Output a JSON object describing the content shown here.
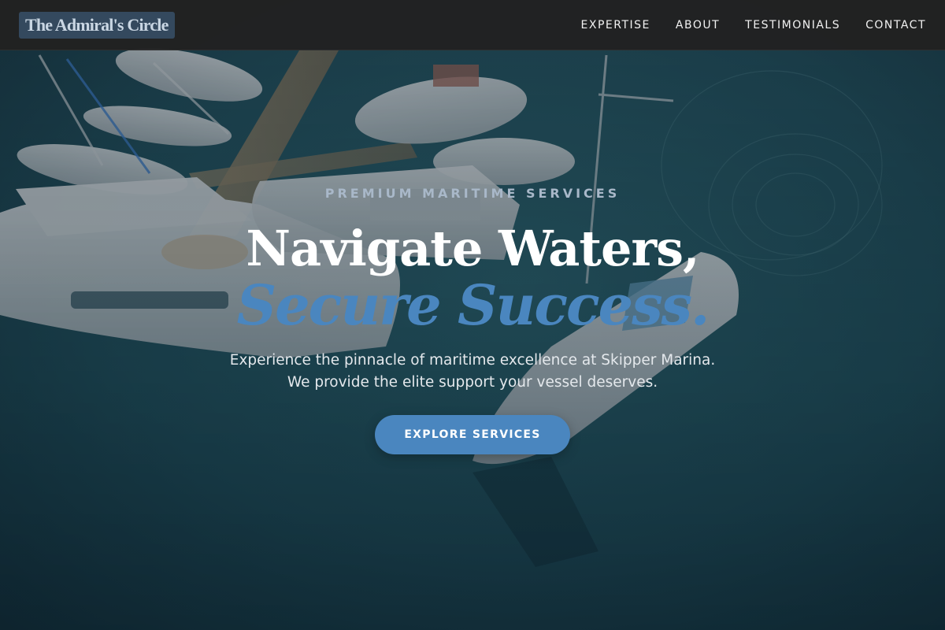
{
  "header": {
    "brand": "The Admiral's Circle",
    "nav": [
      {
        "label": "EXPERTISE"
      },
      {
        "label": "ABOUT"
      },
      {
        "label": "TESTIMONIALS"
      },
      {
        "label": "CONTACT"
      }
    ]
  },
  "hero": {
    "eyebrow": "PREMIUM MARITIME SERVICES",
    "headline_line1": "Navigate Waters,",
    "headline_line2": "Secure Success.",
    "tagline_line1": "Experience the pinnacle of maritime excellence at Skipper Marina.",
    "tagline_line2": "We provide the elite support your vessel deserves.",
    "cta_label": "EXPLORE SERVICES",
    "background_image": "marina-yachts-aerial-photo"
  },
  "colors": {
    "navbar": "#222222",
    "brand_badge": "#34495e",
    "brand_text": "#c9d6e3",
    "accent": "#4a86bf",
    "eyebrow": "#a9b8c9",
    "water": "#1d4a56"
  }
}
